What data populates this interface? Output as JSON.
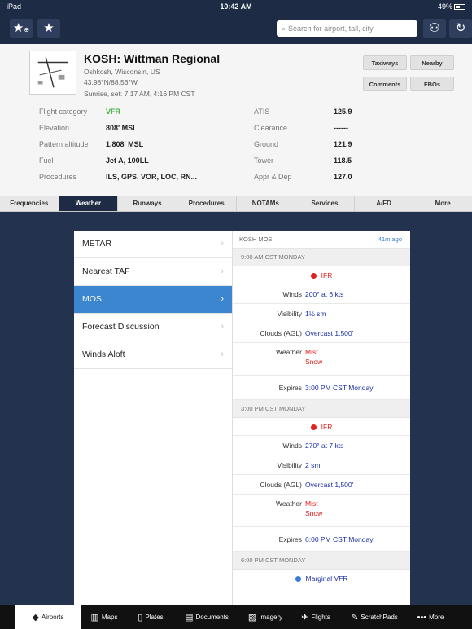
{
  "status": {
    "left": "iPad",
    "time": "10:42 AM",
    "right": "49%"
  },
  "top_nav": {
    "add_icon": "star-plus-icon",
    "favorites_icon": "star-icon",
    "search_placeholder": "Search for airport, tail, city",
    "user_icon": "user-icon",
    "sync_icon": "refresh-icon"
  },
  "airport": {
    "title": "KOSH: Wittman Regional",
    "location": "Oshkosh, Wisconsin, US",
    "coords": "43.98°N/88.56°W",
    "sun": "Sunrise, set: 7:17 AM, 4:16 PM CST",
    "buttons": {
      "taxiways": "Taxiways",
      "nearby": "Nearby",
      "comments": "Comments",
      "fbos": "FBOs"
    },
    "info_left": [
      {
        "label": "Flight category",
        "value": "VFR"
      },
      {
        "label": "Elevation",
        "value": "808' MSL"
      },
      {
        "label": "Pattern altitude",
        "value": "1,808' MSL"
      },
      {
        "label": "Fuel",
        "value": "Jet A, 100LL"
      },
      {
        "label": "Procedures",
        "value": "ILS, GPS, VOR, LOC, RN..."
      }
    ],
    "info_right": [
      {
        "label": "ATIS",
        "value": "125.9"
      },
      {
        "label": "Clearance",
        "value": "------"
      },
      {
        "label": "Ground",
        "value": "121.9"
      },
      {
        "label": "Tower",
        "value": "118.5"
      },
      {
        "label": "Appr & Dep",
        "value": "127.0"
      }
    ]
  },
  "tabs": [
    "Frequencies",
    "Weather",
    "Runways",
    "Procedures",
    "NOTAMs",
    "Services",
    "A/FD",
    "More"
  ],
  "weather_list": [
    "METAR",
    "Nearest TAF",
    "MOS",
    "Forecast Discussion",
    "Winds Aloft"
  ],
  "mos": {
    "header": "KOSH MOS",
    "ago": "41m ago",
    "labels": {
      "winds": "Winds",
      "visibility": "Visibility",
      "clouds": "Clouds (AGL)",
      "weather": "Weather",
      "expires": "Expires"
    },
    "periods": [
      {
        "title": "9:00 AM CST MONDAY",
        "category": "IFR",
        "winds": "200° at 6 kts",
        "visibility": "1½ sm",
        "clouds": "Overcast 1,500'",
        "weather1": "Mist",
        "weather2": "Snow",
        "expires": "3:00 PM CST Monday"
      },
      {
        "title": "3:00 PM CST MONDAY",
        "category": "IFR",
        "winds": "270° at 7 kts",
        "visibility": "2 sm",
        "clouds": "Overcast 1,500'",
        "weather1": "Mist",
        "weather2": "Snow",
        "expires": "6:00 PM CST Monday"
      },
      {
        "title": "6:00 PM CST MONDAY",
        "category": "Marginal VFR"
      }
    ]
  },
  "bottom_nav": [
    "Airports",
    "Maps",
    "Plates",
    "Documents",
    "Imagery",
    "Flights",
    "ScratchPads",
    "More"
  ],
  "colors": {
    "nav_bg": "#1d2b45",
    "active_blue": "#3c85cf",
    "ifr_red": "#e02222",
    "mvfr_blue": "#3a7bd5",
    "vfr_green": "#3db33d"
  }
}
